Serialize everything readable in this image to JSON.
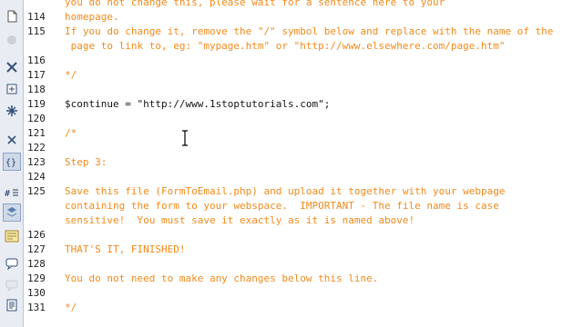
{
  "toolbar": {
    "buttons": [
      {
        "name": "open-documents-icon",
        "state": "normal"
      },
      {
        "name": "collapse-tag-icon",
        "state": "disabled"
      },
      {
        "name": "collapse-selection-icon",
        "state": "normal"
      },
      {
        "name": "expand-all-icon",
        "state": "normal"
      },
      {
        "name": "select-parent-tag-icon",
        "state": "normal"
      },
      {
        "name": "balance-braces-icon",
        "state": "normal"
      },
      {
        "name": "line-numbers-icon",
        "state": "active"
      },
      {
        "name": "highlight-invalid-code-icon",
        "state": "normal"
      },
      {
        "name": "syntax-coloring-icon",
        "state": "active"
      },
      {
        "name": "apply-comment-icon",
        "state": "normal"
      },
      {
        "name": "remove-comment-icon",
        "state": "normal"
      },
      {
        "name": "wrap-tag-icon",
        "state": "disabled"
      },
      {
        "name": "recent-snippets-icon",
        "state": "normal"
      }
    ]
  },
  "editor": {
    "lines": [
      {
        "num": "",
        "text": "you do not change this, please wait for a sentence here to your",
        "kind": "comment"
      },
      {
        "num": "114",
        "text": "homepage.",
        "kind": "comment"
      },
      {
        "num": "115",
        "text": "If you do change it, remove the \"/\" symbol below and replace with the name of the",
        "kind": "comment"
      },
      {
        "num": "",
        "text": " page to link to, eg: \"mypage.htm\" or \"http://www.elsewhere.com/page.htm\"",
        "kind": "comment"
      },
      {
        "num": "116",
        "text": "",
        "kind": "comment"
      },
      {
        "num": "117",
        "text": "*/",
        "kind": "comment"
      },
      {
        "num": "118",
        "text": "",
        "kind": "comment"
      },
      {
        "num": "119",
        "text": "$continue = \"http://www.1stoptutorials.com\";",
        "kind": "php"
      },
      {
        "num": "120",
        "text": "",
        "kind": "comment"
      },
      {
        "num": "121",
        "text": "/*",
        "kind": "comment"
      },
      {
        "num": "122",
        "text": "",
        "kind": "comment"
      },
      {
        "num": "123",
        "text": "Step 3:",
        "kind": "comment"
      },
      {
        "num": "124",
        "text": "",
        "kind": "comment"
      },
      {
        "num": "125",
        "text": "Save this file (FormToEmail.php) and upload it together with your webpage",
        "kind": "comment"
      },
      {
        "num": "",
        "text": "containing the form to your webspace.  IMPORTANT - The file name is case",
        "kind": "comment"
      },
      {
        "num": "",
        "text": "sensitive!  You must save it exactly as it is named above!",
        "kind": "comment"
      },
      {
        "num": "126",
        "text": "",
        "kind": "comment"
      },
      {
        "num": "127",
        "text": "THAT'S IT, FINISHED!",
        "kind": "comment"
      },
      {
        "num": "128",
        "text": "",
        "kind": "comment"
      },
      {
        "num": "129",
        "text": "You do not need to make any changes below this line.",
        "kind": "comment"
      },
      {
        "num": "130",
        "text": "",
        "kind": "comment"
      },
      {
        "num": "131",
        "text": "*/",
        "kind": "comment"
      }
    ],
    "colors": {
      "comment": "#f28a1b",
      "php": "#141414",
      "gutter_bg": "#ffffff",
      "toolbar_bg": "#e9edf3"
    }
  },
  "cursor": {
    "name": "text-cursor-icon"
  }
}
